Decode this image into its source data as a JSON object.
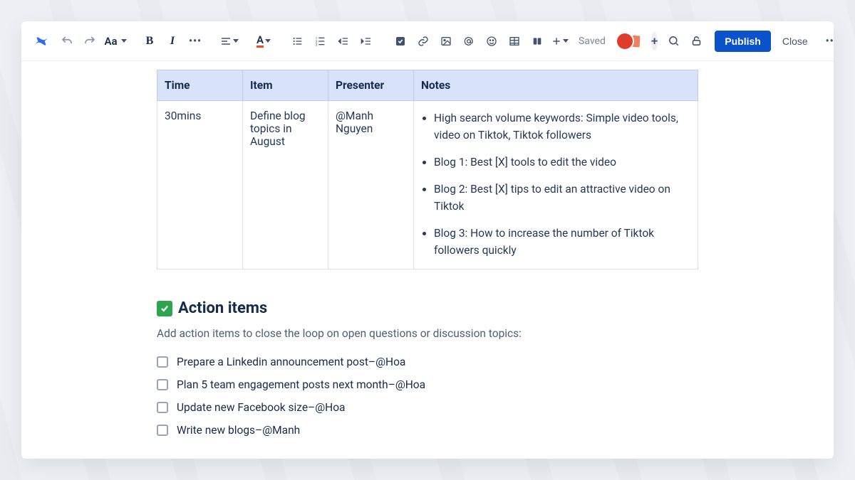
{
  "toolbar": {
    "textStyleLabel": "Aa",
    "savedLabel": "Saved",
    "publishLabel": "Publish",
    "closeLabel": "Close"
  },
  "table": {
    "headers": {
      "time": "Time",
      "item": "Item",
      "presenter": "Presenter",
      "notes": "Notes"
    },
    "row": {
      "time": "30mins",
      "item": "Define blog topics in August",
      "presenter": "@Manh Nguyen",
      "notes": [
        "High search volume keywords: Simple video tools, video on Tiktok, Tiktok followers",
        "Blog 1: Best [X] tools to edit the video",
        "Blog 2: Best [X] tips to edit an attractive video on Tiktok",
        "Blog 3: How to increase the number of Tiktok followers quickly"
      ]
    }
  },
  "actionSection": {
    "title": "Action items",
    "hint": "Add action items to close the loop on open questions or discussion topics:",
    "items": [
      "Prepare a Linkedin announcement post–@Hoa",
      "Plan 5 team engagement posts next month–@Hoa",
      "Update new Facebook size–@Hoa",
      "Write new blogs–@Manh"
    ]
  }
}
